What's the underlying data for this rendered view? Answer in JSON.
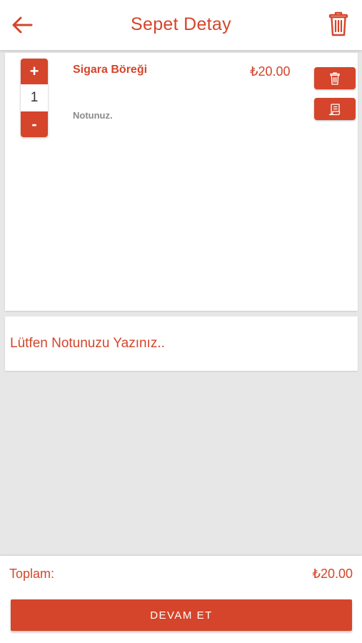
{
  "header": {
    "title": "Sepet Detay",
    "back_icon": "arrow-left-icon",
    "clear_icon": "trash-icon"
  },
  "cart": {
    "items": [
      {
        "name": "Sigara Böreği",
        "price": "₺20.00",
        "quantity": "1",
        "note": "Notunuz.",
        "increment_label": "+",
        "decrement_label": "-",
        "delete_icon": "trash-icon",
        "note_icon": "receipt-icon"
      }
    ]
  },
  "note_input": {
    "placeholder": "Lütfen Notunuzu Yazınız.."
  },
  "footer": {
    "total_label": "Toplam:",
    "total_value": "₺20.00",
    "continue_label": "DEVAM ET"
  },
  "colors": {
    "accent": "#d4452b",
    "background": "#e7e7e7",
    "card": "#ffffff",
    "muted_text": "#8a8a8a"
  }
}
